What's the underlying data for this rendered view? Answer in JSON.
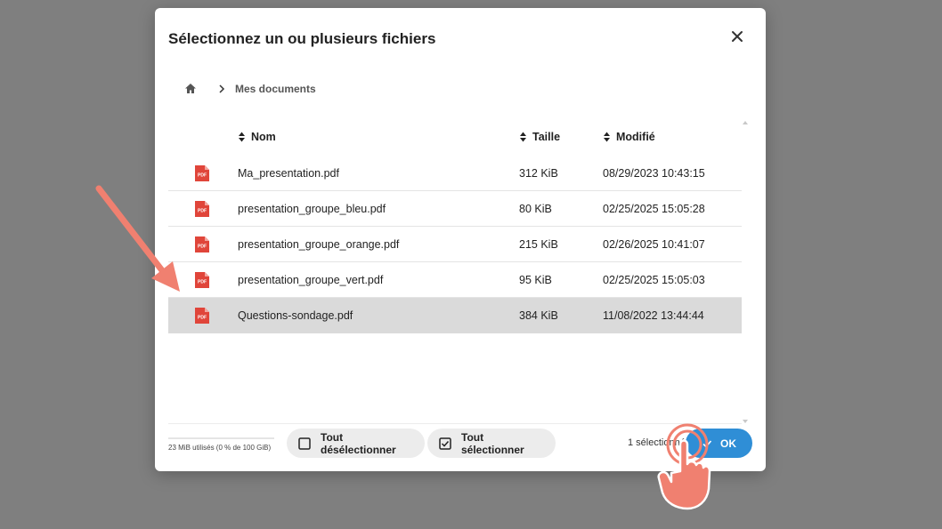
{
  "dialog": {
    "title": "Sélectionnez un ou plusieurs fichiers",
    "close_icon": "close-icon"
  },
  "breadcrumb": {
    "home_icon": "home-icon",
    "separator_icon": "chevron-right-icon",
    "current": "Mes documents"
  },
  "table": {
    "columns": {
      "name": "Nom",
      "size": "Taille",
      "modified": "Modifié"
    },
    "sort_icon": "sort-icon",
    "file_icon": "pdf-file-icon",
    "file_icon_label": "PDF",
    "rows": [
      {
        "name": "Ma_presentation.pdf",
        "size": "312 KiB",
        "modified": "08/29/2023 10:43:15",
        "selected": false
      },
      {
        "name": "presentation_groupe_bleu.pdf",
        "size": "80 KiB",
        "modified": "02/25/2025 15:05:28",
        "selected": false
      },
      {
        "name": "presentation_groupe_orange.pdf",
        "size": "215 KiB",
        "modified": "02/26/2025 10:41:07",
        "selected": false
      },
      {
        "name": "presentation_groupe_vert.pdf",
        "size": "95 KiB",
        "modified": "02/25/2025 15:05:03",
        "selected": false
      },
      {
        "name": "Questions-sondage.pdf",
        "size": "384 KiB",
        "modified": "11/08/2022 13:44:44",
        "selected": true
      }
    ]
  },
  "footer": {
    "usage": "23 MiB utilisés (0 % de 100 GiB)",
    "deselect_all": "Tout désélectionner",
    "select_all": "Tout sélectionner",
    "selection_count": "1 sélectionné",
    "ok": "OK"
  },
  "colors": {
    "accent": "#2f8ed6",
    "pdf_red": "#e0453a",
    "annotation": "#f08070",
    "selected_row": "#dadada"
  }
}
